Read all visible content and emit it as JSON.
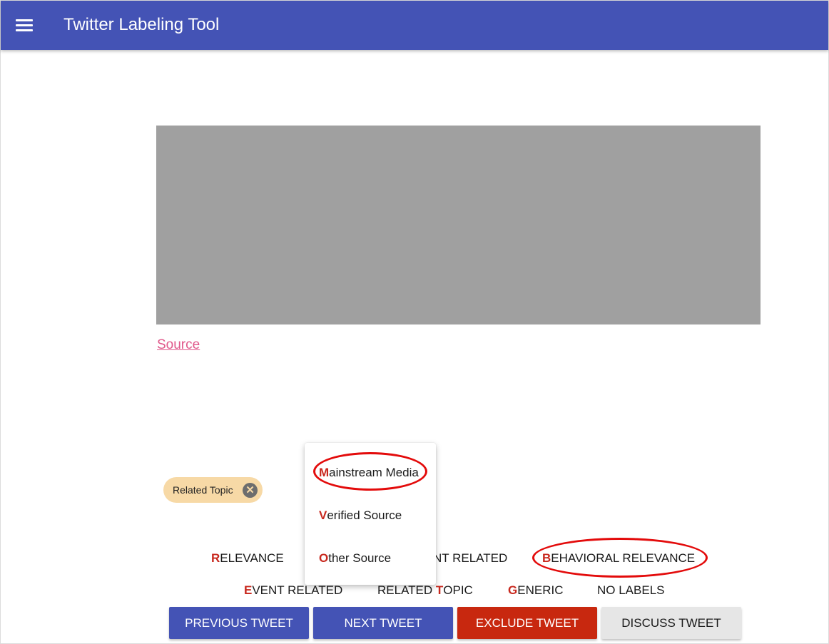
{
  "app": {
    "title": "Twitter Labeling Tool",
    "menu_icon": "hamburger-menu-icon"
  },
  "tweet": {
    "source_link": "Source"
  },
  "selected_labels": [
    {
      "label": "Related Topic",
      "remove_icon": "close-circle-icon"
    }
  ],
  "label_row1": {
    "relevance": {
      "key": "R",
      "rest": "ELEVANCE"
    },
    "hidden_label_tail": "NT RELATED",
    "behavioral": {
      "key": "B",
      "rest": "EHAVIORAL RELEVANCE"
    }
  },
  "label_row2": {
    "event": {
      "key": "E",
      "rest": "VENT RELATED"
    },
    "related_topic": {
      "pre": "RELATED ",
      "key": "T",
      "rest": "OPIC"
    },
    "generic": {
      "key": "G",
      "rest": "ENERIC"
    },
    "no_labels": "NO LABELS"
  },
  "dropdown": [
    {
      "key": "M",
      "rest": "ainstream Media"
    },
    {
      "key": "V",
      "rest": "erified Source"
    },
    {
      "key": "O",
      "rest": "ther Source"
    }
  ],
  "actions": {
    "previous": "PREVIOUS TWEET",
    "next": "NEXT TWEET",
    "exclude": "EXCLUDE TWEET",
    "discuss": "DISCUSS TWEET"
  },
  "colors": {
    "primary": "#4453b5",
    "danger": "#c8280f",
    "shortcut_key": "#c8281e",
    "chip": "#f7d9a6",
    "annotation_ring": "#e30b0b",
    "link": "#e0588a"
  }
}
